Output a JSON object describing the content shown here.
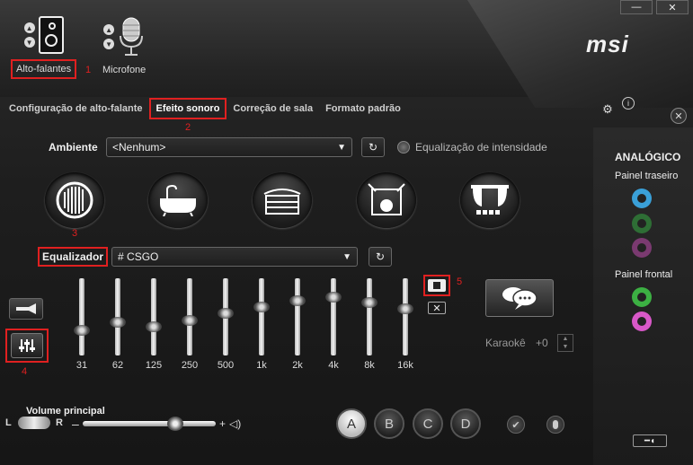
{
  "window": {
    "minimize_label": "—",
    "close_label": "✕",
    "brand": "msi"
  },
  "devices": [
    {
      "label": "Alto-falantes",
      "tag": "1"
    },
    {
      "label": "Microfone"
    }
  ],
  "tabs": [
    {
      "label": "Configuração de alto-falante"
    },
    {
      "label": "Efeito sonoro",
      "tag": "2"
    },
    {
      "label": "Correção de sala"
    },
    {
      "label": "Formato padrão"
    }
  ],
  "environment": {
    "label": "Ambiente",
    "value": "<Nenhum>",
    "loudness_label": "Equalização de intensidade"
  },
  "presets_tag": "3",
  "equalizer": {
    "label": "Equalizador",
    "value": "# CSGO",
    "save_tag": "5",
    "button_tag": "4",
    "bands": [
      {
        "freq": "31",
        "level": 0.3
      },
      {
        "freq": "62",
        "level": 0.42
      },
      {
        "freq": "125",
        "level": 0.35
      },
      {
        "freq": "250",
        "level": 0.45
      },
      {
        "freq": "500",
        "level": 0.55
      },
      {
        "freq": "1k",
        "level": 0.65
      },
      {
        "freq": "2k",
        "level": 0.75
      },
      {
        "freq": "4k",
        "level": 0.8
      },
      {
        "freq": "8k",
        "level": 0.72
      },
      {
        "freq": "16k",
        "level": 0.62
      }
    ]
  },
  "karaoke": {
    "label": "Karaokê",
    "value": "+0"
  },
  "volume": {
    "label": "Volume principal",
    "left": "L",
    "right": "R",
    "minus": "–",
    "plus": "+",
    "level": 0.72
  },
  "profiles": [
    "A",
    "B",
    "C",
    "D"
  ],
  "side": {
    "title": "ANALÓGICO",
    "rear": "Painel traseiro",
    "front": "Painel frontal"
  },
  "colors": {
    "accent_red": "#e02020",
    "jack_blue": "#3aa0d8",
    "jack_green": "#3cb043",
    "jack_pink": "#d858c8"
  }
}
